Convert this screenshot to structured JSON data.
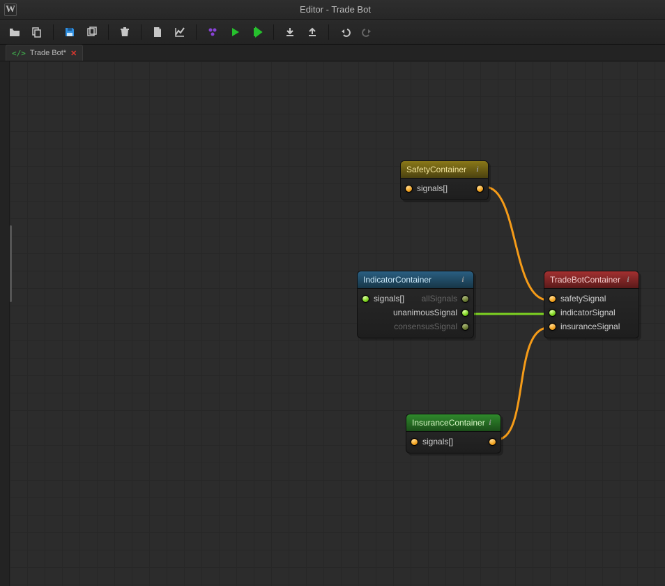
{
  "title": "Editor - Trade Bot",
  "tab": {
    "label": "Trade Bot*"
  },
  "nodes": {
    "safety": {
      "title": "SafetyContainer",
      "input": "signals[]"
    },
    "indicator": {
      "title": "IndicatorContainer",
      "input": "signals[]",
      "out1": "allSignals",
      "out2": "unanimousSignal",
      "out3": "consensusSignal"
    },
    "insurance": {
      "title": "InsuranceContainer",
      "input": "signals[]"
    },
    "tradebot": {
      "title": "TradeBotContainer",
      "in1": "safetySignal",
      "in2": "indicatorSignal",
      "in3": "insuranceSignal"
    }
  }
}
